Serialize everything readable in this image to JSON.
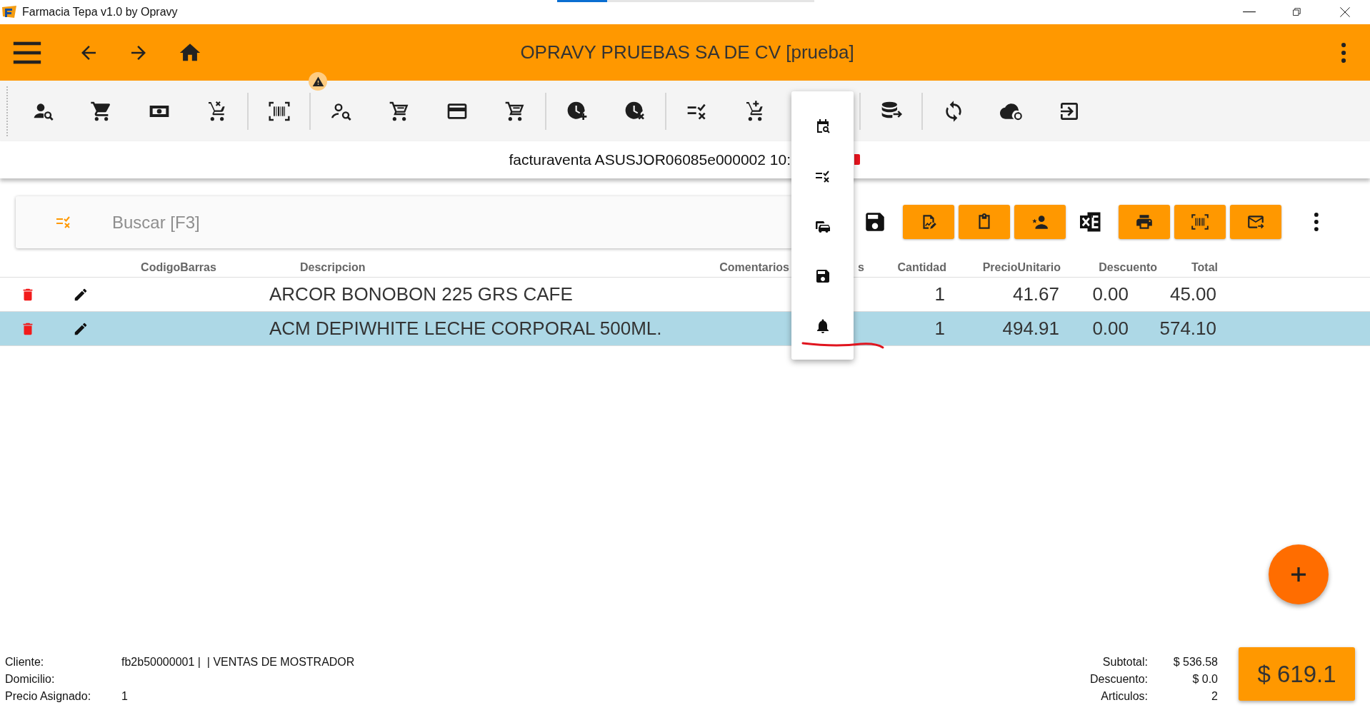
{
  "window": {
    "title": "Farmacia Tepa v1.0 by Opravy"
  },
  "app_bar": {
    "title": "OPRAVY PRUEBAS SA DE CV [prueba]"
  },
  "document_line": {
    "text": "facturaventa ASUSJOR06085e000002 10:"
  },
  "search": {
    "placeholder": "Buscar [F3]"
  },
  "table": {
    "columns": [
      "CodigoBarras",
      "Descripcion",
      "Comentarios",
      "s",
      "Cantidad",
      "PrecioUnitario",
      "Descuento",
      "Total"
    ],
    "rows": [
      {
        "descripcion": "ARCOR BONOBON 225 GRS CAFE",
        "cantidad": "1",
        "precio_unitario": "41.67",
        "descuento": "0.00",
        "total": "45.00",
        "selected": false
      },
      {
        "descripcion": "ACM DEPIWHITE LECHE CORPORAL 500ML.",
        "cantidad": "1",
        "precio_unitario": "494.91",
        "descuento": "0.00",
        "total": "574.10",
        "selected": true
      }
    ]
  },
  "footer": {
    "client_info": [
      {
        "label": "Cliente:",
        "value": "fb2b50000001 |  | VENTAS DE MOSTRADOR"
      },
      {
        "label": "Domicilio:"
      },
      {
        "label": "Precio Asignado:",
        "value": "1"
      }
    ],
    "totals": [
      {
        "label": "Subtotal:",
        "value": "$ 536.58"
      },
      {
        "label": "Descuento:",
        "value": "$ 0.0"
      },
      {
        "label": "Articulos:",
        "value": "2"
      }
    ],
    "total_button": "$ 619.1"
  }
}
